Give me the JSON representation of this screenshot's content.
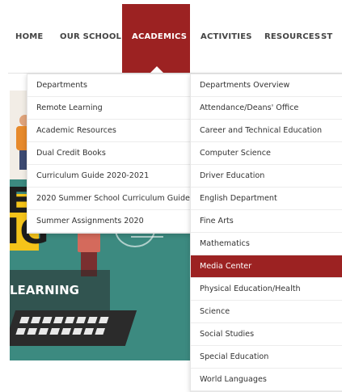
{
  "nav": {
    "items": [
      "HOME",
      "OUR SCHOOL",
      "ACADEMICS",
      "ACTIVITIES",
      "RESOURCES",
      "ST"
    ],
    "active": "ACADEMICS",
    "accent_color": "#9c2222"
  },
  "hero": {
    "letters_line1": "E",
    "letters_line2": "IG",
    "caption": "LEARNING"
  },
  "menu_left": {
    "items": [
      "Departments",
      "Remote Learning",
      "Academic Resources",
      "Dual Credit Books",
      "Curriculum Guide 2020-2021",
      "2020 Summer School Curriculum Guide",
      "Summer Assignments 2020"
    ]
  },
  "menu_right": {
    "items": [
      "Departments Overview",
      "Attendance/Deans' Office",
      "Career and Technical Education",
      "Computer Science",
      "Driver Education",
      "English Department",
      "Fine Arts",
      "Mathematics",
      "Media Center",
      "Physical Education/Health",
      "Science",
      "Social Studies",
      "Special Education",
      "World Languages"
    ],
    "highlighted": "Media Center",
    "highlight_color": "#9c2222"
  }
}
